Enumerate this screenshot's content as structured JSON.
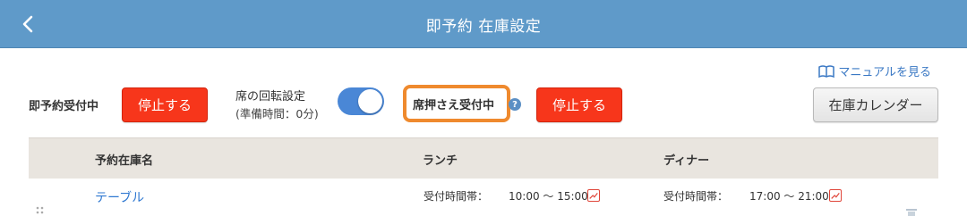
{
  "header": {
    "title": "即予約 在庫設定"
  },
  "manual": {
    "label": "マニュアルを見る"
  },
  "controls": {
    "instant_label": "即予約受付中",
    "stop_label": "停止する",
    "rotation_title": "席の回転設定",
    "rotation_sub": "(準備時間：0分)",
    "oshi_label": "席押さえ受付中",
    "help": "?",
    "stop_label_2": "停止する",
    "calendar_label": "在庫カレンダー"
  },
  "table": {
    "headers": [
      "予約在庫名",
      "ランチ",
      "ディナー"
    ],
    "rows": [
      {
        "name": "テーブル",
        "lunch_label": "受付時間帯：",
        "lunch_time": "10:00 〜 15:00",
        "dinner_label": "受付時間帯：",
        "dinner_time": "17:00 〜 21:00"
      }
    ]
  },
  "colors": {
    "header_bg": "#5f9ac9",
    "stop_button": "#f7361b",
    "highlight": "#ef8a2e",
    "toggle_on": "#4a87d6"
  }
}
